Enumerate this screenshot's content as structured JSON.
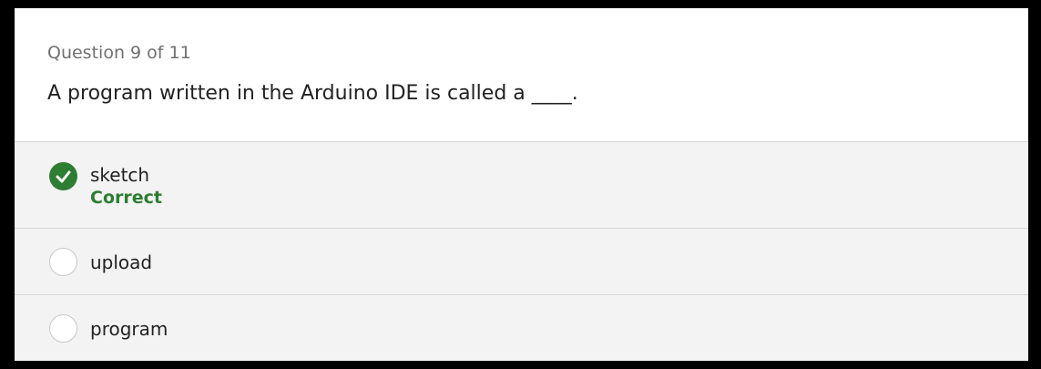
{
  "question": {
    "counter": "Question 9 of 11",
    "text": "A program written in the Arduino IDE is called a ____."
  },
  "options": [
    {
      "label": "sketch",
      "selected": true,
      "feedback": "Correct",
      "status_color": "#2d7d32",
      "icon": "check-circle-icon"
    },
    {
      "label": "upload",
      "selected": false,
      "icon": "radio-empty-icon"
    },
    {
      "label": "program",
      "selected": false,
      "icon": "radio-empty-icon"
    }
  ]
}
